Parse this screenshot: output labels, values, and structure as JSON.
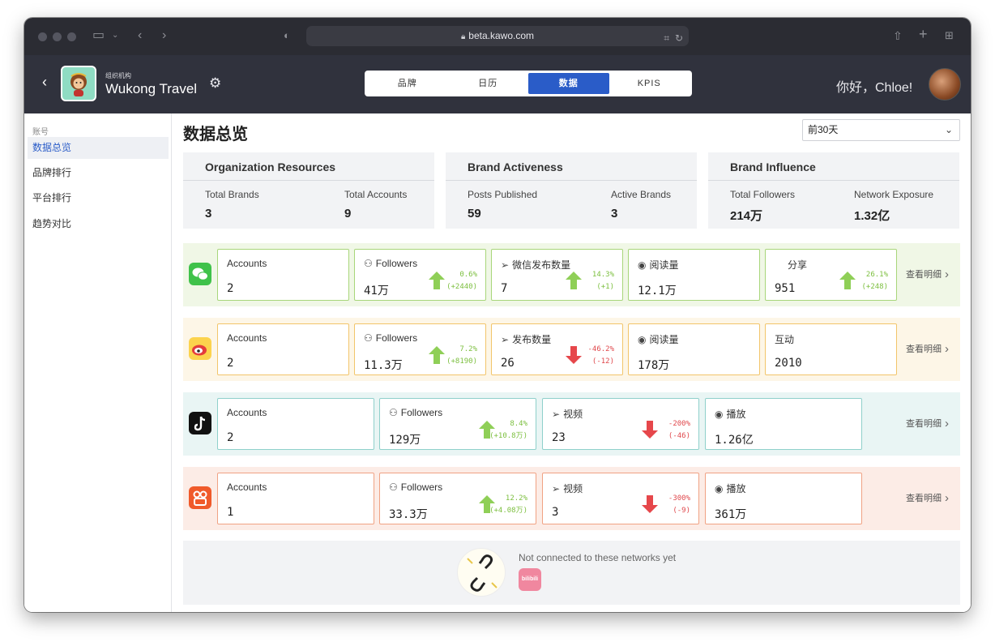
{
  "browser": {
    "url": "beta.kawo.com"
  },
  "header": {
    "org_sub": "组织机构",
    "org_name": "Wukong Travel",
    "tabs": [
      {
        "label": "品牌"
      },
      {
        "label": "日历"
      },
      {
        "label": "数据",
        "active": true
      },
      {
        "label": "KPIS"
      }
    ],
    "greeting": "你好，Chloe!"
  },
  "sidebar": {
    "heading": "账号",
    "items": [
      {
        "label": "数据总览",
        "active": true
      },
      {
        "label": "品牌排行"
      },
      {
        "label": "平台排行"
      },
      {
        "label": "趋势对比"
      }
    ]
  },
  "main": {
    "title": "数据总览",
    "range_select": "前30天"
  },
  "summary": [
    {
      "title": "Organization Resources",
      "stats": [
        {
          "label": "Total Brands",
          "value": "3"
        },
        {
          "label": "Total Accounts",
          "value": "9"
        }
      ]
    },
    {
      "title": "Brand Activeness",
      "stats": [
        {
          "label": "Posts Published",
          "value": "59"
        },
        {
          "label": "Active Brands",
          "value": "3"
        }
      ]
    },
    {
      "title": "Brand Influence",
      "stats": [
        {
          "label": "Total Followers",
          "value": "214万"
        },
        {
          "label": "Network Exposure",
          "value": "1.32亿"
        }
      ]
    }
  ],
  "networks": [
    {
      "icon": "wechat-icon",
      "bg": "#f0f7e6",
      "border": "#a8d67a",
      "detail": "查看明细",
      "cards": [
        {
          "label": "Accounts",
          "value": "2"
        },
        {
          "label": "Followers",
          "icon": "followers-icon",
          "value": "41万",
          "pct": "0.6%",
          "abs": "(+2440)",
          "dir": "up"
        },
        {
          "label": "微信发布数量",
          "icon": "send-icon",
          "value": "7",
          "pct": "14.3%",
          "abs": "(+1)",
          "dir": "up"
        },
        {
          "label": "阅读量",
          "icon": "eye-icon",
          "value": "12.1万"
        },
        {
          "label": "分享",
          "icon": "share-icon",
          "value": "951",
          "pct": "26.1%",
          "abs": "(+248)",
          "dir": "up"
        }
      ]
    },
    {
      "icon": "weibo-icon",
      "bg": "#fdf6e7",
      "border": "#f2c56a",
      "detail": "查看明细",
      "cards": [
        {
          "label": "Accounts",
          "value": "2"
        },
        {
          "label": "Followers",
          "icon": "followers-icon",
          "value": "11.3万",
          "pct": "7.2%",
          "abs": "(+8190)",
          "dir": "up"
        },
        {
          "label": "发布数量",
          "icon": "send-icon",
          "value": "26",
          "pct": "-46.2%",
          "abs": "(-12)",
          "dir": "down"
        },
        {
          "label": "阅读量",
          "icon": "eye-icon",
          "value": "178万"
        },
        {
          "label": "互动",
          "value": "2010"
        }
      ]
    },
    {
      "icon": "douyin-icon",
      "bg": "#e9f5f4",
      "border": "#8fd0cb",
      "detail": "查看明细",
      "cards": [
        {
          "label": "Accounts",
          "value": "2"
        },
        {
          "label": "Followers",
          "icon": "followers-icon",
          "value": "129万",
          "pct": "8.4%",
          "abs": "(+10.8万)",
          "dir": "up"
        },
        {
          "label": "视频",
          "icon": "send-icon",
          "value": "23",
          "pct": "-200%",
          "abs": "(-46)",
          "dir": "down"
        },
        {
          "label": "播放",
          "icon": "eye-icon",
          "value": "1.26亿"
        }
      ]
    },
    {
      "icon": "kuaishou-icon",
      "bg": "#fcece6",
      "border": "#f0a283",
      "detail": "查看明细",
      "cards": [
        {
          "label": "Accounts",
          "value": "1"
        },
        {
          "label": "Followers",
          "icon": "followers-icon",
          "value": "33.3万",
          "pct": "12.2%",
          "abs": "(+4.08万)",
          "dir": "up"
        },
        {
          "label": "视频",
          "icon": "send-icon",
          "value": "3",
          "pct": "-300%",
          "abs": "(-9)",
          "dir": "down"
        },
        {
          "label": "播放",
          "icon": "eye-icon",
          "value": "361万"
        }
      ]
    }
  ],
  "not_connected": {
    "text": "Not connected to these networks yet",
    "networks": [
      {
        "icon": "bilibili-icon",
        "label": "bilibili"
      }
    ]
  }
}
